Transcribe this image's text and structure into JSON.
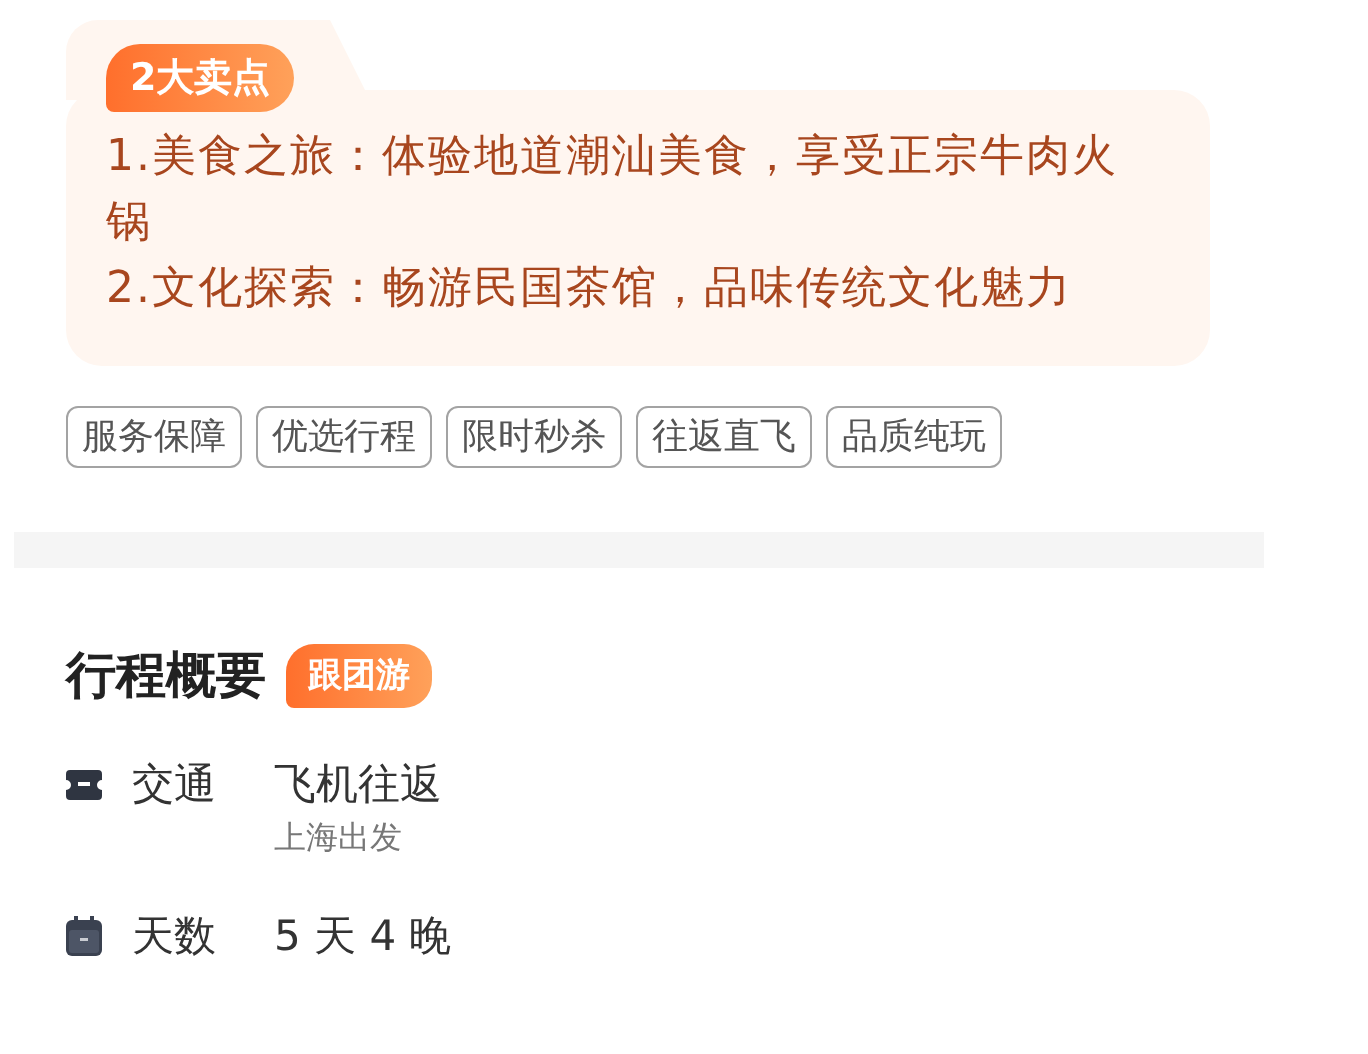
{
  "highlights": {
    "badge": "2大卖点",
    "points": [
      "1.美食之旅：体验地道潮汕美食，享受正宗牛肉火锅",
      "2.文化探索：畅游民国茶馆，品味传统文化魅力"
    ]
  },
  "tags": [
    "服务保障",
    "优选行程",
    "限时秒杀",
    "往返直飞",
    "品质纯玩"
  ],
  "overview": {
    "title": "行程概要",
    "badge": "跟团游",
    "rows": [
      {
        "kind": "transport",
        "label": "交通",
        "value": "飞机往返",
        "note": "上海出发"
      },
      {
        "kind": "days",
        "label": "天数",
        "value": "5 天 4 晚"
      }
    ]
  }
}
